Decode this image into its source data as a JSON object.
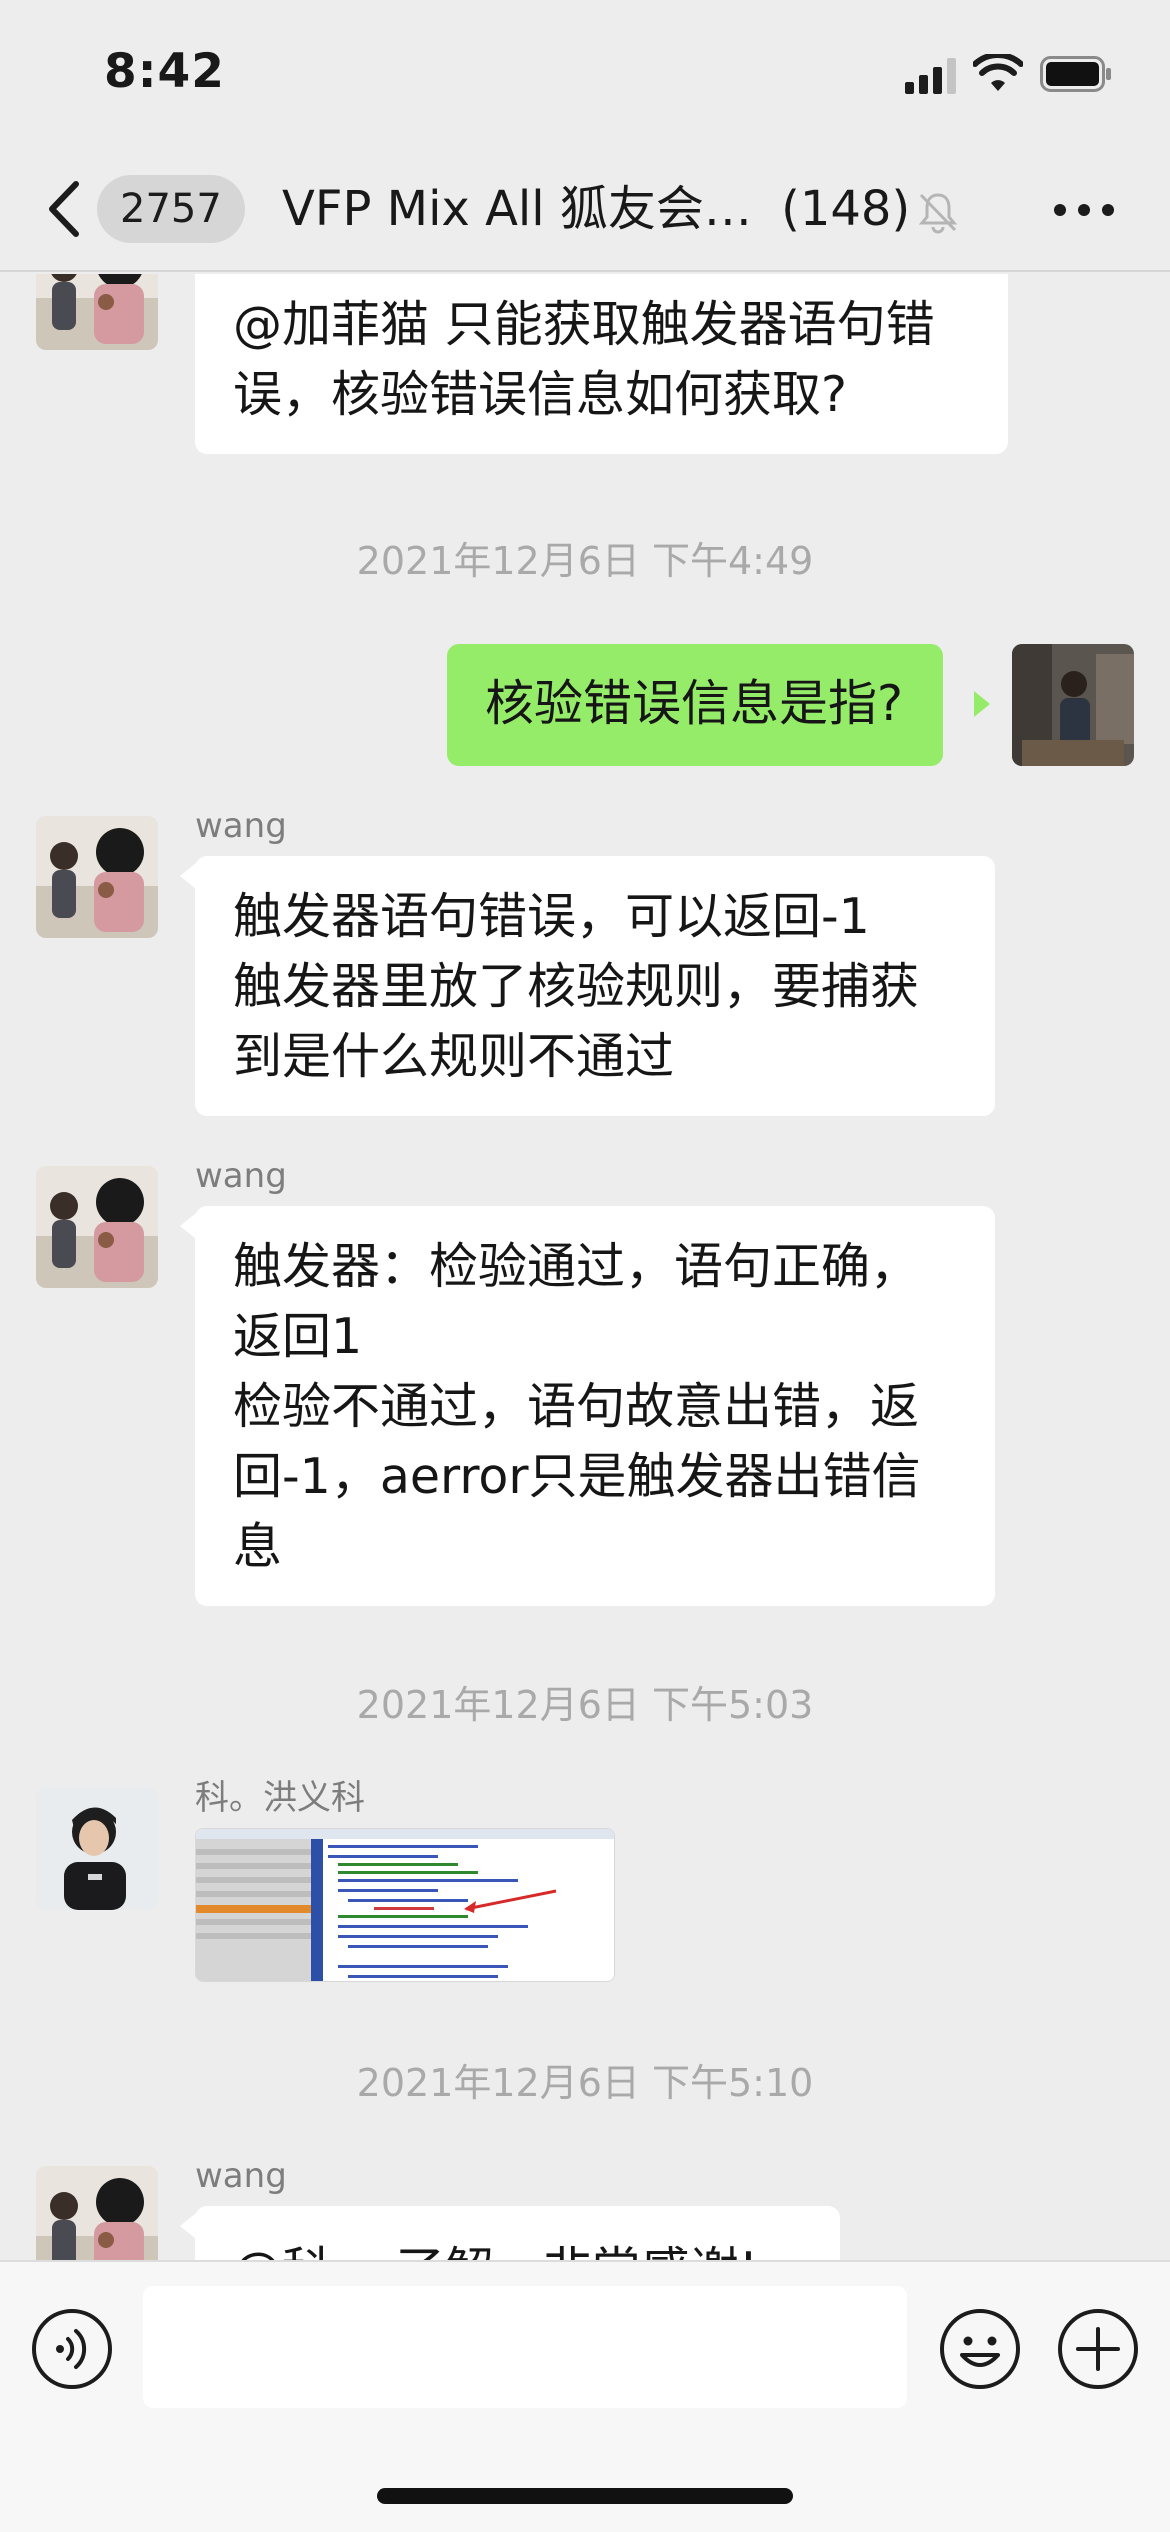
{
  "status_bar": {
    "time": "8:42"
  },
  "header": {
    "unread_count": "2757",
    "title": "VFP Mix All 狐友会…",
    "member_count": "(148)"
  },
  "messages": {
    "m1": {
      "lines": [
        "@加菲猫 只能获取触发器语句错",
        "误，核验错误信息如何获取?"
      ]
    },
    "ts1": "2021年12月6日 下午4:49",
    "m2": {
      "text": "核验错误信息是指?"
    },
    "m3": {
      "sender": "wang",
      "lines": [
        "触发器语句错误，可以返回-1",
        "触发器里放了核验规则，要捕获",
        "到是什么规则不通过"
      ]
    },
    "m4": {
      "sender": "wang",
      "lines": [
        "触发器：检验通过，语句正确，",
        "返回1",
        "检验不通过，语句故意出错，返",
        "回-1，aerror只是触发器出错信",
        "息"
      ]
    },
    "ts2": "2021年12月6日 下午5:03",
    "m5": {
      "sender": "科。洪义科"
    },
    "ts3": "2021年12月6日 下午5:10",
    "m6": {
      "sender": "wang",
      "partial_text": "@科。 了解，非常感谢!"
    }
  },
  "input": {
    "placeholder": ""
  },
  "colors": {
    "background": "#ededed",
    "my_bubble": "#95ec69",
    "their_bubble": "#ffffff",
    "timestamp": "#a9a9a9"
  },
  "icons": [
    "back-icon",
    "mute-icon",
    "more-icon",
    "voice-icon",
    "emoji-icon",
    "plus-icon"
  ]
}
